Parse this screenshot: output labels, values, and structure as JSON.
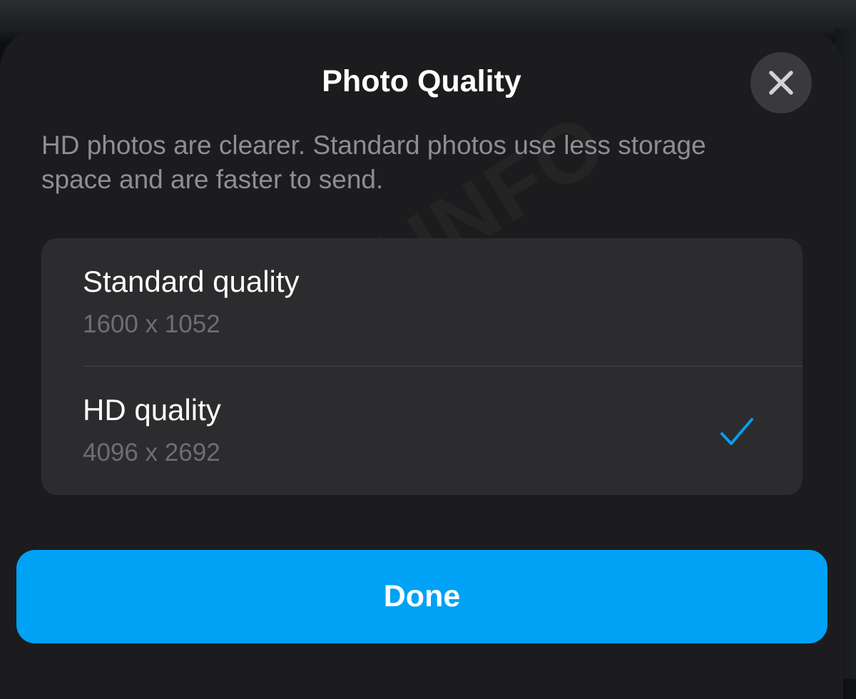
{
  "sheet": {
    "title": "Photo Quality",
    "description": "HD photos are clearer. Standard photos use less storage space and are faster to send."
  },
  "close_button": {
    "icon": "close-icon"
  },
  "options": [
    {
      "label": "Standard quality",
      "resolution": "1600 x 1052",
      "selected": false
    },
    {
      "label": "HD quality",
      "resolution": "4096 x 2692",
      "selected": true
    }
  ],
  "checkmark": {
    "icon": "checkmark-icon",
    "color": "#0a9df0"
  },
  "done_button": {
    "label": "Done",
    "color": "#00a2f5"
  },
  "watermark": {
    "text": "WABETAINFO"
  }
}
